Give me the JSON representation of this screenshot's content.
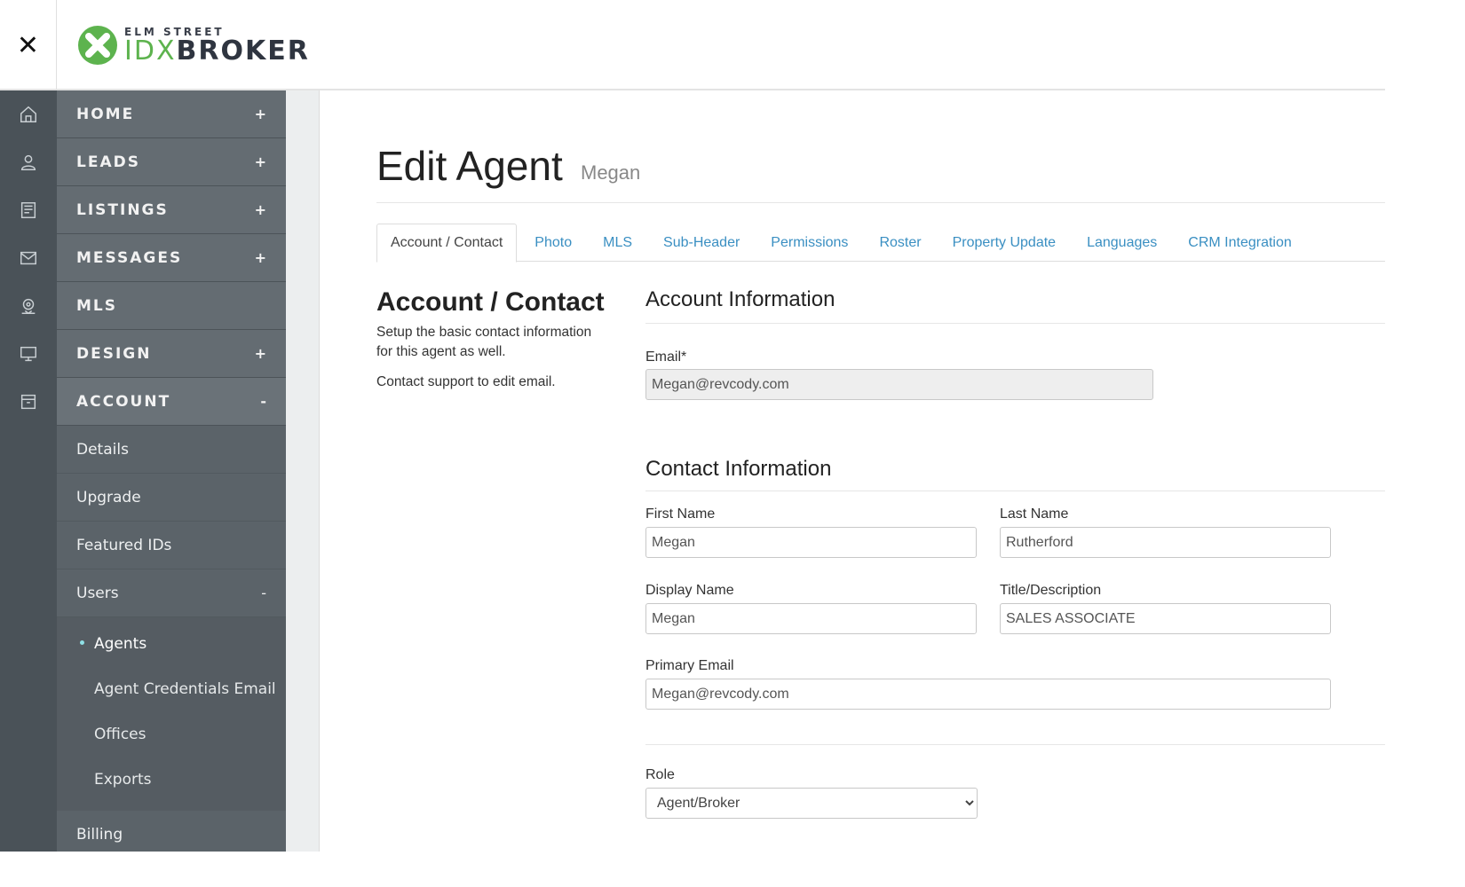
{
  "header": {
    "close_label": "✕",
    "logo_top": "ELM STREET",
    "logo_idx": "IDX",
    "logo_broker": "BROKER"
  },
  "colors": {
    "nav_bg": "#5b6369",
    "iconbar_bg": "#4a5258",
    "link": "#3a8fc2",
    "brand_green": "#5db34e"
  },
  "iconbar": [
    "home-icon",
    "user-icon",
    "listings-icon",
    "mail-icon",
    "map-pin-icon",
    "monitor-icon",
    "archive-icon"
  ],
  "nav": {
    "items": [
      {
        "label": "HOME",
        "toggle": "+"
      },
      {
        "label": "LEADS",
        "toggle": "+"
      },
      {
        "label": "LISTINGS",
        "toggle": "+"
      },
      {
        "label": "MESSAGES",
        "toggle": "+"
      },
      {
        "label": "MLS",
        "toggle": ""
      },
      {
        "label": "DESIGN",
        "toggle": "+"
      },
      {
        "label": "ACCOUNT",
        "toggle": "-"
      }
    ],
    "account_sub": [
      {
        "label": "Details"
      },
      {
        "label": "Upgrade"
      },
      {
        "label": "Featured IDs"
      },
      {
        "label": "Users",
        "toggle": "-"
      }
    ],
    "users_sub": [
      {
        "label": "Agents"
      },
      {
        "label": "Agent Credentials Email"
      },
      {
        "label": "Offices"
      },
      {
        "label": "Exports"
      }
    ],
    "billing": "Billing"
  },
  "page": {
    "title": "Edit Agent",
    "subtitle": "Megan"
  },
  "tabs": [
    "Account / Contact",
    "Photo",
    "MLS",
    "Sub-Header",
    "Permissions",
    "Roster",
    "Property Update",
    "Languages",
    "CRM Integration"
  ],
  "section": {
    "title": "Account / Contact",
    "desc": "Setup the basic contact information for this agent as well.",
    "note": "Contact support to edit email."
  },
  "form": {
    "account_heading": "Account Information",
    "email_label": "Email*",
    "email_value": "Megan@revcody.com",
    "contact_heading": "Contact Information",
    "first_name_label": "First Name",
    "first_name_value": "Megan",
    "last_name_label": "Last Name",
    "last_name_value": "Rutherford",
    "display_name_label": "Display Name",
    "display_name_value": "Megan",
    "title_label": "Title/Description",
    "title_value": "SALES ASSOCIATE",
    "primary_email_label": "Primary Email",
    "primary_email_value": "Megan@revcody.com",
    "role_label": "Role",
    "role_value": "Agent/Broker"
  }
}
